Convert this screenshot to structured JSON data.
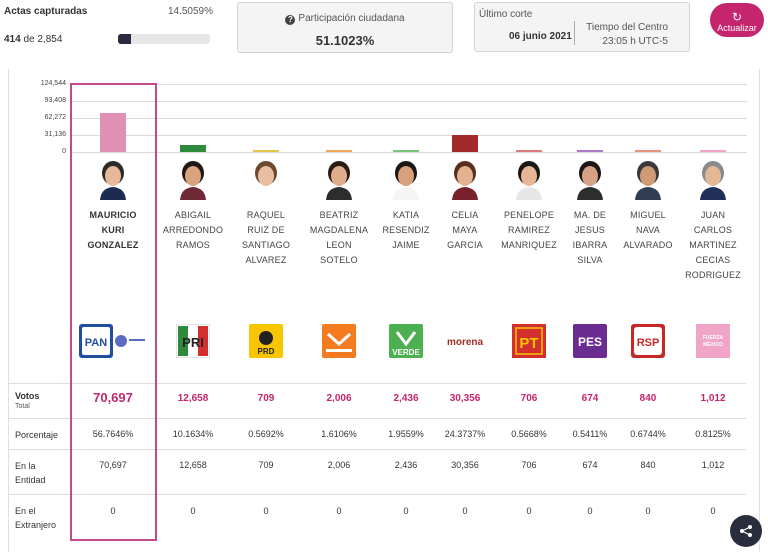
{
  "actas": {
    "title": "Actas capturadas",
    "percent": "14.5059%",
    "captured": "414",
    "of_word": "de",
    "total": "2,854",
    "progress": 0.145
  },
  "participacion": {
    "title": "Participación ciudadana",
    "value": "51.1023%"
  },
  "corte": {
    "title": "Último corte",
    "date": "06 junio 2021",
    "tz_line1": "Tiempo del Centro",
    "tz_line2": "23:05 h UTC-5"
  },
  "refresh_label": "Actualizar",
  "chart": {
    "ticks": [
      "124,544",
      "93,408",
      "62,272",
      "31,136",
      "0"
    ],
    "max": 124544
  },
  "rows": {
    "votos_label": "Votos",
    "votos_sub": "Total",
    "porcentaje_label": "Porcentaje",
    "entidad_label1": "En la",
    "entidad_label2": "Entidad",
    "extranjero_label1": "En el",
    "extranjero_label2": "Extranjero"
  },
  "candidates": [
    {
      "name": [
        "MAURICIO",
        "KURI",
        "GONZALEZ"
      ],
      "party": "PAN",
      "votes": "70,697",
      "votes_num": 70697,
      "percent": "56.7646%",
      "entidad": "70,697",
      "extranjero": "0",
      "color": "#e08fb5"
    },
    {
      "name": [
        "ABIGAIL",
        "ARREDONDO",
        "RAMOS"
      ],
      "party": "PRI",
      "votes": "12,658",
      "votes_num": 12658,
      "percent": "10.1634%",
      "entidad": "12,658",
      "extranjero": "0",
      "color": "#2e8b3c"
    },
    {
      "name": [
        "RAQUEL",
        "RUIZ DE",
        "SANTIAGO",
        "ALVAREZ"
      ],
      "party": "PRD",
      "votes": "709",
      "votes_num": 709,
      "percent": "0.5692%",
      "entidad": "709",
      "extranjero": "0",
      "color": "#e3c74a"
    },
    {
      "name": [
        "BEATRIZ",
        "MAGDALENA",
        "LEON",
        "SOTELO"
      ],
      "party": "MOVIMIENTO CIUDADANO",
      "votes": "2,006",
      "votes_num": 2006,
      "percent": "1.6106%",
      "entidad": "2,006",
      "extranjero": "0",
      "color": "#f2a65a"
    },
    {
      "name": [
        "KATIA",
        "RESENDIZ",
        "JAIME"
      ],
      "party": "VERDE",
      "votes": "2,436",
      "votes_num": 2436,
      "percent": "1.9559%",
      "entidad": "2,436",
      "extranjero": "0",
      "color": "#7cc47a"
    },
    {
      "name": [
        "CELIA",
        "MAYA",
        "GARCIA"
      ],
      "party": "morena",
      "votes": "30,356",
      "votes_num": 30356,
      "percent": "24.3737%",
      "entidad": "30,356",
      "extranjero": "0",
      "color": "#a32a2a"
    },
    {
      "name": [
        "PENELOPE",
        "RAMIREZ",
        "MANRIQUEZ"
      ],
      "party": "PT",
      "votes": "706",
      "votes_num": 706,
      "percent": "0.5668%",
      "entidad": "706",
      "extranjero": "0",
      "color": "#e07a7a"
    },
    {
      "name": [
        "MA. DE",
        "JESUS",
        "IBARRA",
        "SILVA"
      ],
      "party": "PES",
      "votes": "674",
      "votes_num": 674,
      "percent": "0.5411%",
      "entidad": "674",
      "extranjero": "0",
      "color": "#b07ac9"
    },
    {
      "name": [
        "MIGUEL",
        "NAVA",
        "ALVARADO"
      ],
      "party": "RSP",
      "votes": "840",
      "votes_num": 840,
      "percent": "0.6744%",
      "entidad": "840",
      "extranjero": "0",
      "color": "#e69080"
    },
    {
      "name": [
        "JUAN",
        "CARLOS",
        "MARTINEZ",
        "CECIAS",
        "RODRIGUEZ"
      ],
      "party": "FUERZA MÉXICO",
      "votes": "1,012",
      "votes_num": 1012,
      "percent": "0.8125%",
      "entidad": "1,012",
      "extranjero": "0",
      "color": "#f0a5c8"
    }
  ]
}
